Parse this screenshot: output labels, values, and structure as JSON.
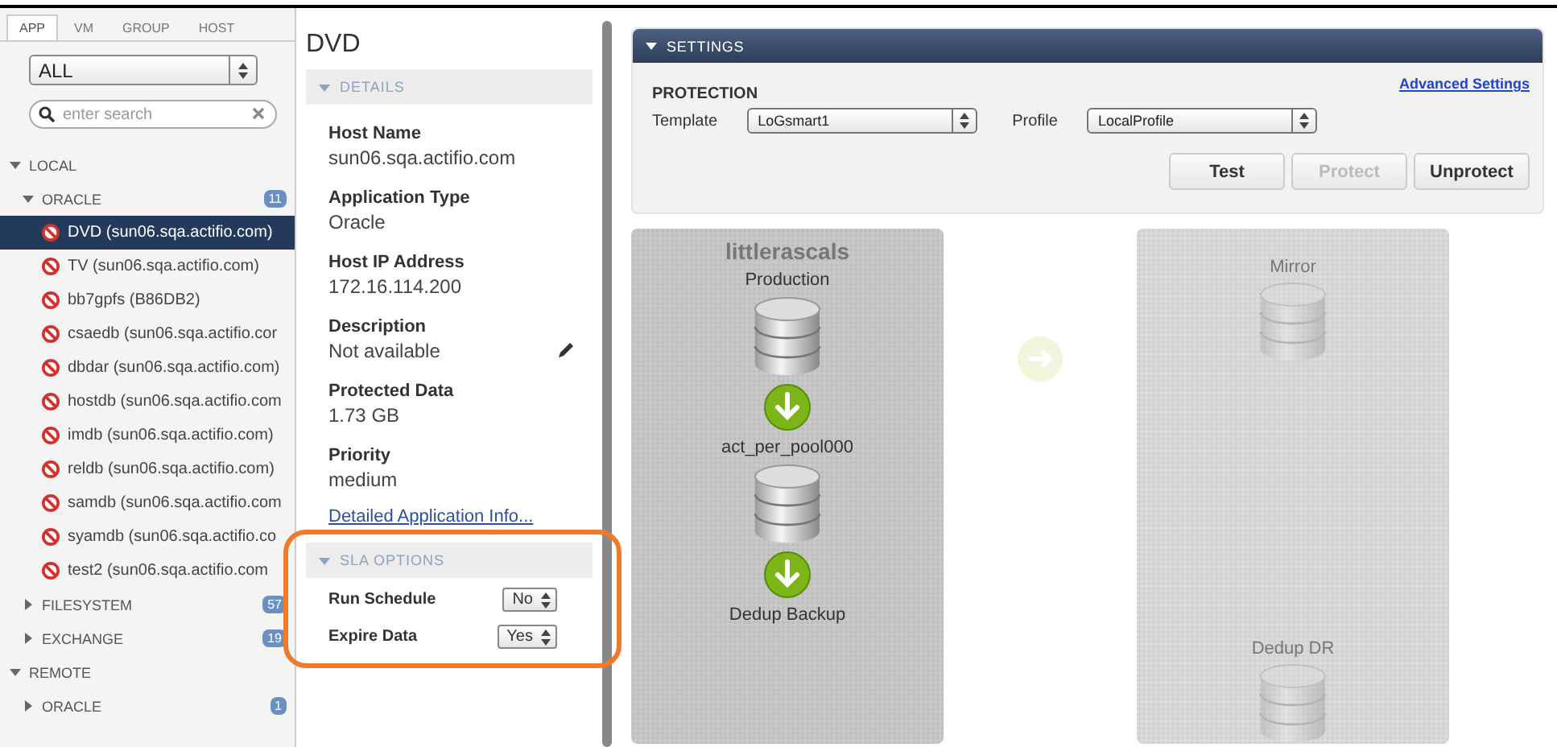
{
  "sidebar": {
    "tabs": [
      {
        "label": "APP",
        "selected": true
      },
      {
        "label": "VM",
        "selected": false
      },
      {
        "label": "GROUP",
        "selected": false
      },
      {
        "label": "HOST",
        "selected": false
      }
    ],
    "filter": {
      "value": "ALL"
    },
    "search": {
      "placeholder": "enter search"
    },
    "tree": [
      {
        "label": "LOCAL",
        "expanded": true,
        "children": [
          {
            "label": "ORACLE",
            "expanded": true,
            "count": "11",
            "children": [
              {
                "label": "DVD (sun06.sqa.actifio.com)",
                "selected": true
              },
              {
                "label": "TV (sun06.sqa.actifio.com)",
                "selected": false
              },
              {
                "label": "bb7gpfs (B86DB2)",
                "selected": false
              },
              {
                "label": "csaedb (sun06.sqa.actifio.cor",
                "selected": false
              },
              {
                "label": "dbdar (sun06.sqa.actifio.com)",
                "selected": false
              },
              {
                "label": "hostdb (sun06.sqa.actifio.com",
                "selected": false
              },
              {
                "label": "imdb (sun06.sqa.actifio.com)",
                "selected": false
              },
              {
                "label": "reldb (sun06.sqa.actifio.com)",
                "selected": false
              },
              {
                "label": "samdb (sun06.sqa.actifio.com",
                "selected": false
              },
              {
                "label": "syamdb (sun06.sqa.actifio.co",
                "selected": false
              },
              {
                "label": "test2 (sun06.sqa.actifio.com",
                "selected": false
              }
            ]
          },
          {
            "label": "FILESYSTEM",
            "expanded": false,
            "count": "57"
          },
          {
            "label": "EXCHANGE",
            "expanded": false,
            "count": "19"
          }
        ]
      },
      {
        "label": "REMOTE",
        "expanded": true,
        "children": [
          {
            "label": "ORACLE",
            "expanded": false,
            "count": "1"
          }
        ]
      }
    ]
  },
  "details": {
    "title": "DVD",
    "section": "DETAILS",
    "fields": [
      {
        "label": "Host Name",
        "value": "sun06.sqa.actifio.com",
        "editable": false
      },
      {
        "label": "Application Type",
        "value": "Oracle",
        "editable": false
      },
      {
        "label": "Host IP Address",
        "value": "172.16.114.200",
        "editable": false
      },
      {
        "label": "Description",
        "value": "Not available",
        "editable": true
      },
      {
        "label": "Protected Data",
        "value": "1.73 GB",
        "editable": false
      },
      {
        "label": "Priority",
        "value": "medium",
        "editable": false
      }
    ],
    "link": "Detailed Application Info...",
    "sla": {
      "title": "SLA OPTIONS",
      "highlighted": true,
      "options": [
        {
          "label": "Run Schedule",
          "value": "No"
        },
        {
          "label": "Expire Data",
          "value": "Yes"
        }
      ]
    }
  },
  "settings": {
    "title": "SETTINGS",
    "section": "PROTECTION",
    "advanced_link": "Advanced Settings",
    "template": {
      "label": "Template",
      "value": "LoGsmart1"
    },
    "profile": {
      "label": "Profile",
      "value": "LocalProfile"
    },
    "buttons": [
      {
        "label": "Test",
        "disabled": false
      },
      {
        "label": "Protect",
        "disabled": true
      },
      {
        "label": "Unprotect",
        "disabled": false
      }
    ]
  },
  "diagram": {
    "panels": [
      {
        "title": "littlerascals",
        "faded": false,
        "stages": [
          "Production",
          "act_per_pool000",
          "Dedup Backup"
        ]
      },
      {
        "faded": true,
        "stages": [
          "Mirror",
          "Dedup DR"
        ]
      }
    ]
  }
}
